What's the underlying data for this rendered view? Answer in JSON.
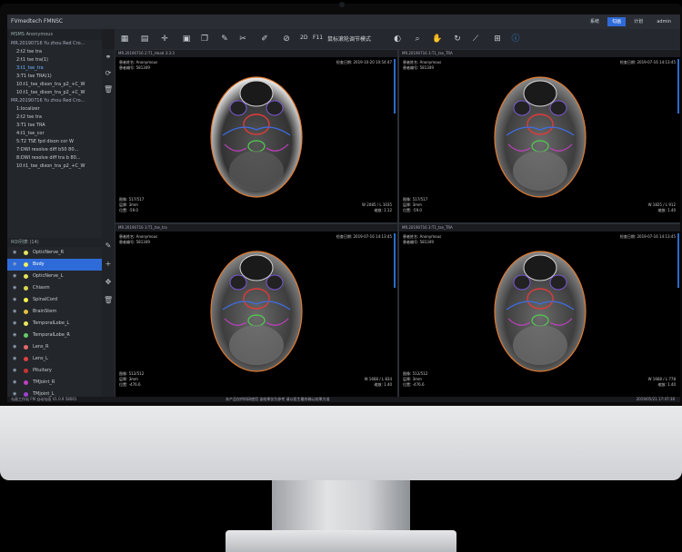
{
  "window": {
    "app_title": "FVmedtech FMNSC",
    "tabs": [
      "系统",
      "勾画",
      "计划"
    ],
    "active_tab": 1,
    "user": "admin"
  },
  "toolbar": {
    "text1": "2D",
    "text2": "F11",
    "text3": "鼠标滚轮调节模式"
  },
  "left_panel": {
    "patient": "MSMS Anonymous",
    "series": [
      {
        "label": "MR.20190716 Yu zhou Red Cro...",
        "group": true
      },
      {
        "label": "2:t2 tse tra"
      },
      {
        "label": "2:t1 tse tra(1)"
      },
      {
        "label": "3:t1_tse_tra",
        "selected": true
      },
      {
        "label": "3:T1 tse TRA(1)"
      },
      {
        "label": "10:t1_tse_dixon_tra_p2_+C_W"
      },
      {
        "label": "10:t1_tse_dixon_tra_p2_+C_W"
      },
      {
        "label": "MR.20190716 Yu zhou Red Cro...",
        "group": true
      },
      {
        "label": "1:localizer"
      },
      {
        "label": "2:t2 tse tra"
      },
      {
        "label": "3:T1 tse TRA"
      },
      {
        "label": "4:t1_tse_cor"
      },
      {
        "label": "5:T2 TSE fpd dixon cor W"
      },
      {
        "label": "7:DWI resolve diff b50 80..."
      },
      {
        "label": "8:DWI resolve diff tra b 80..."
      },
      {
        "label": "10:t1_tse_dixon_tra_p2_+C_W"
      }
    ],
    "roi_header": "ROI列表 (14)",
    "rois": [
      {
        "name": "OpticNerve_R",
        "color": "#e3e35a"
      },
      {
        "name": "Body",
        "color": "#f0f060",
        "selected": true
      },
      {
        "name": "OpticNerve_L",
        "color": "#e3e35a"
      },
      {
        "name": "Chiasm",
        "color": "#d8d84c"
      },
      {
        "name": "SpinalCord",
        "color": "#f2f24a"
      },
      {
        "name": "BrainStem",
        "color": "#e0c040"
      },
      {
        "name": "TemporalLobe_L",
        "color": "#e8e85a"
      },
      {
        "name": "TemporalLobe_R",
        "color": "#66cc66"
      },
      {
        "name": "Lens_R",
        "color": "#e36a6a"
      },
      {
        "name": "Lens_L",
        "color": "#e04040"
      },
      {
        "name": "Pituitary",
        "color": "#cc3333"
      },
      {
        "name": "TMJoint_R",
        "color": "#c040c0"
      },
      {
        "name": "TMjoint_L",
        "color": "#a040d0"
      },
      {
        "name": "Eye_R",
        "color": "#4060e0"
      }
    ]
  },
  "viewports": [
    {
      "title": "MR.20190716 2:T1_Head 3:3:3",
      "patient": "患者姓名: Anonymous",
      "id": "患者编号: 581349",
      "date": "检查日期: 2019-10-20 10:54:47",
      "img": "图像: 517/517",
      "wl": "W 2085 / L 1035",
      "zoom": "缩放: 1.12",
      "thick": "层厚: 3mm",
      "pos": "位置: -59.0"
    },
    {
      "title": "MR.20190716 3:T1_tse_TRA",
      "patient": "患者姓名: Anonymous",
      "id": "患者编号: 581349",
      "date": "检查日期: 2019-07-16 14:13:45",
      "img": "图像: 517/517",
      "wl": "W 1825 / L 912",
      "zoom": "缩放: 1.40",
      "thick": "层厚: 3mm",
      "pos": "位置: -59.0"
    },
    {
      "title": "MR.20190716 3:T1_tse_tra",
      "patient": "患者姓名: Anonymous",
      "id": "患者编号: 581349",
      "date": "检查日期: 2019-07-16 14:13:45",
      "img": "图像: 512/512",
      "wl": "W 1668 / L 834",
      "zoom": "缩放: 1.40",
      "thick": "层厚: 3mm",
      "pos": "位置: -476.6"
    },
    {
      "title": "MR.20190716 3:T1_tse_TRA",
      "patient": "患者姓名: Anonymous",
      "id": "患者编号: 581349",
      "date": "检查日期: 2019-07-16 14:13:45",
      "img": "图像: 512/512",
      "wl": "W 1668 / L 778",
      "zoom": "缩放: 1.40",
      "thick": "层厚: 3mm",
      "pos": "位置: -476.6"
    }
  ],
  "status": {
    "left": "勾画工作站 FM 自动勾画 V1.0.9 58001",
    "center": "本产品仅供科研使用 该结果仅为参考 请以医生最终确认结果为准",
    "right": "2019/05/21 17:47:38"
  }
}
